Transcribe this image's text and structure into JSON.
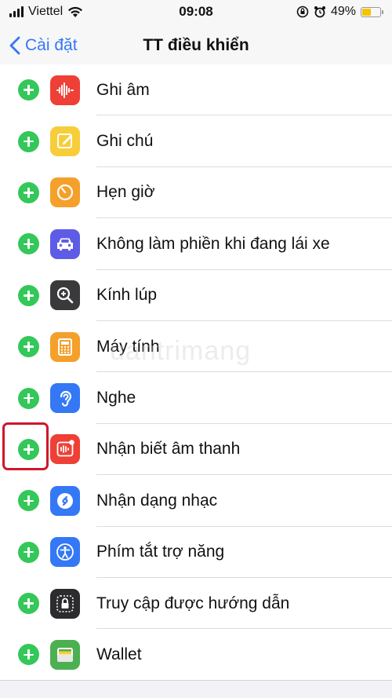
{
  "status_bar": {
    "carrier": "Viettel",
    "time": "09:08",
    "battery_percent": "49%",
    "battery_level": 0.49,
    "battery_color": "#f5c300",
    "icons": [
      "cellular-signal-icon",
      "wifi-icon",
      "orientation-lock-icon",
      "alarm-icon",
      "battery-icon"
    ]
  },
  "nav": {
    "back_label": "Cài đặt",
    "title": "TT điều khiển"
  },
  "watermark": "uantrimang",
  "controls": [
    {
      "label": "Ghi âm",
      "icon": "voice-memo-icon",
      "color": "#ee4036"
    },
    {
      "label": "Ghi chú",
      "icon": "notes-icon",
      "color": "#f7cd3a"
    },
    {
      "label": "Hẹn giờ",
      "icon": "timer-icon",
      "color": "#f4a02b"
    },
    {
      "label": "Không làm phiền khi đang lái xe",
      "icon": "car-icon",
      "color": "#5e5ce6"
    },
    {
      "label": "Kính lúp",
      "icon": "magnifier-icon",
      "color": "#3a3a3c"
    },
    {
      "label": "Máy tính",
      "icon": "calculator-icon",
      "color": "#f4a02b"
    },
    {
      "label": "Nghe",
      "icon": "ear-icon",
      "color": "#3478f6"
    },
    {
      "label": "Nhận biết âm thanh",
      "icon": "sound-recognition-icon",
      "color": "#ee4036"
    },
    {
      "label": "Nhận dạng nhạc",
      "icon": "shazam-icon",
      "color": "#3478f6"
    },
    {
      "label": "Phím tắt trợ năng",
      "icon": "accessibility-icon",
      "color": "#3478f6"
    },
    {
      "label": "Truy cập được hướng dẫn",
      "icon": "guided-access-icon",
      "color": "#2c2c2e"
    },
    {
      "label": "Wallet",
      "icon": "wallet-icon",
      "color": "#4cb050"
    }
  ],
  "colors": {
    "accent": "#3478f6",
    "add_button": "#34c759",
    "highlight": "#d0162b"
  }
}
